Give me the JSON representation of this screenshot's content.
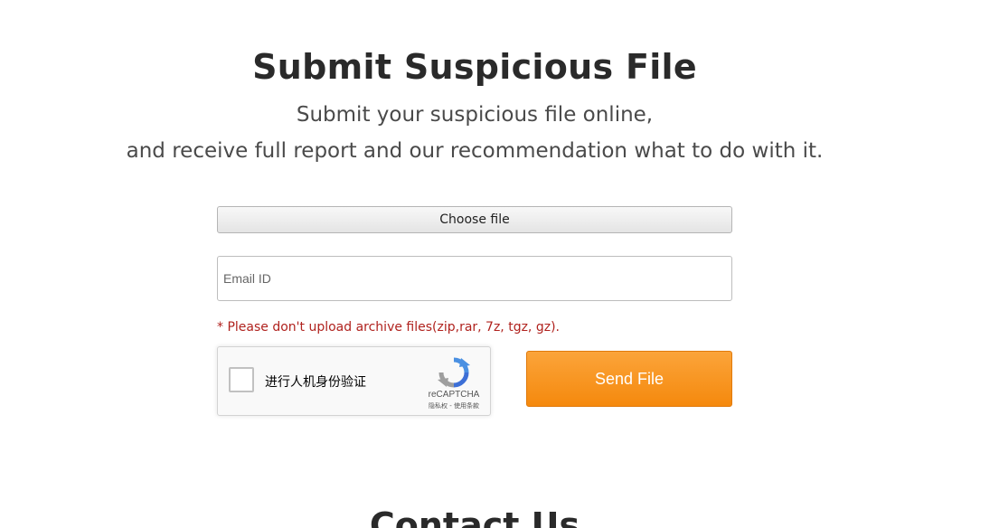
{
  "header": {
    "title": "Submit Suspicious File",
    "subtitle_line1": "Submit your suspicious file online,",
    "subtitle_line2": "and receive full report and our recommendation what to do with it."
  },
  "form": {
    "choose_file_label": "Choose file",
    "email_placeholder": "Email ID",
    "email_value": "",
    "warning_text": "* Please don't upload archive files(zip,rar, 7z, tgz, gz).",
    "send_button_label": "Send File"
  },
  "recaptcha": {
    "checkbox_label": "进行人机身份验证",
    "brand": "reCAPTCHA",
    "links": "隐私权 - 使用条款",
    "checked": false
  },
  "contact_section": {
    "title": "Contact Us"
  },
  "colors": {
    "title": "#2a2a2a",
    "warning": "#b0221e",
    "send_button": "#f5890d"
  }
}
